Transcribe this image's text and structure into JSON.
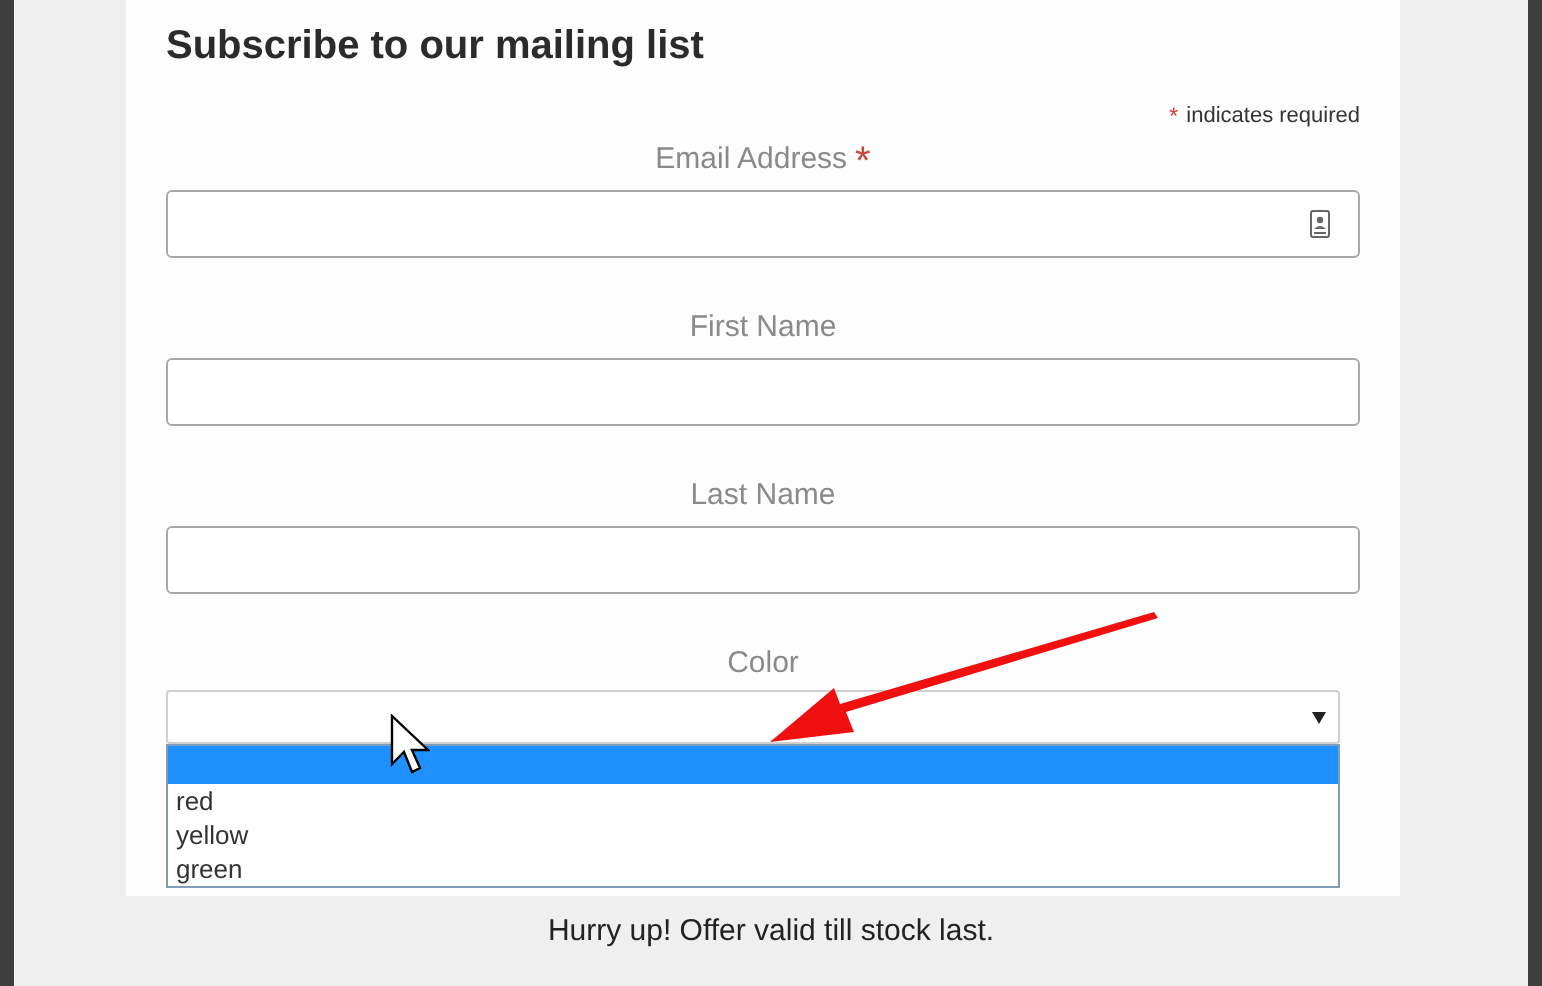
{
  "title": "Subscribe to our mailing list",
  "required_note": {
    "mark": "*",
    "text": "indicates required"
  },
  "fields": [
    {
      "kind": "text",
      "label": "Email Address",
      "required": true,
      "autofill_icon": true
    },
    {
      "kind": "text",
      "label": "First Name",
      "required": false,
      "autofill_icon": false
    },
    {
      "kind": "text",
      "label": "Last Name",
      "required": false,
      "autofill_icon": false
    },
    {
      "kind": "select",
      "label": "Color",
      "required": false,
      "expanded": true,
      "options": [
        {
          "selected": true
        },
        {
          "label": "red",
          "selected": false
        },
        {
          "label": "yellow",
          "selected": false
        },
        {
          "label": "green",
          "selected": false
        }
      ]
    }
  ],
  "footer": "Hurry up! Offer valid till stock last."
}
